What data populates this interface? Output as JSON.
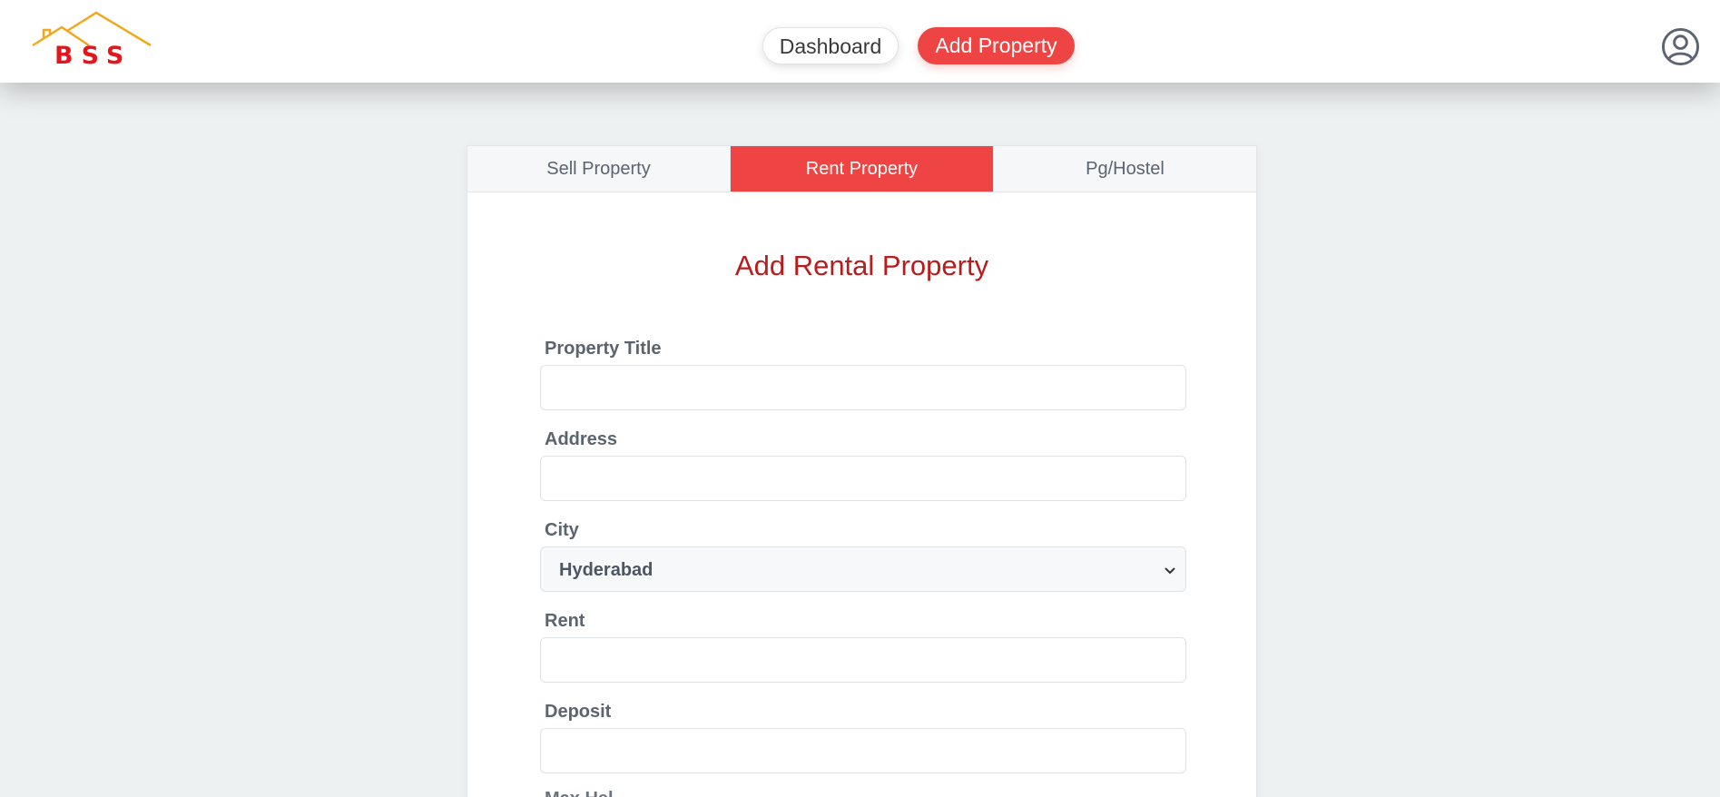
{
  "header": {
    "logo_text": "BSS",
    "nav": {
      "dashboard_label": "Dashboard",
      "add_property_label": "Add Property"
    },
    "user_icon": "user-circle-icon"
  },
  "tabs": [
    {
      "label": "Sell Property",
      "active": false
    },
    {
      "label": "Rent Property",
      "active": true
    },
    {
      "label": "Pg/Hostel",
      "active": false
    }
  ],
  "form": {
    "title": "Add Rental Property",
    "fields": {
      "property_title": {
        "label": "Property Title",
        "value": ""
      },
      "address": {
        "label": "Address",
        "value": ""
      },
      "city": {
        "label": "City",
        "value": "Hyderabad"
      },
      "rent": {
        "label": "Rent",
        "value": ""
      },
      "deposit": {
        "label": "Deposit",
        "value": ""
      },
      "next_partial": {
        "label": "Max Hel"
      }
    }
  },
  "colors": {
    "accent": "#ef4444",
    "title": "#b91c1c",
    "logo_roof": "#f2a81d",
    "logo_text": "#e4161b",
    "background": "#eef1f2"
  }
}
